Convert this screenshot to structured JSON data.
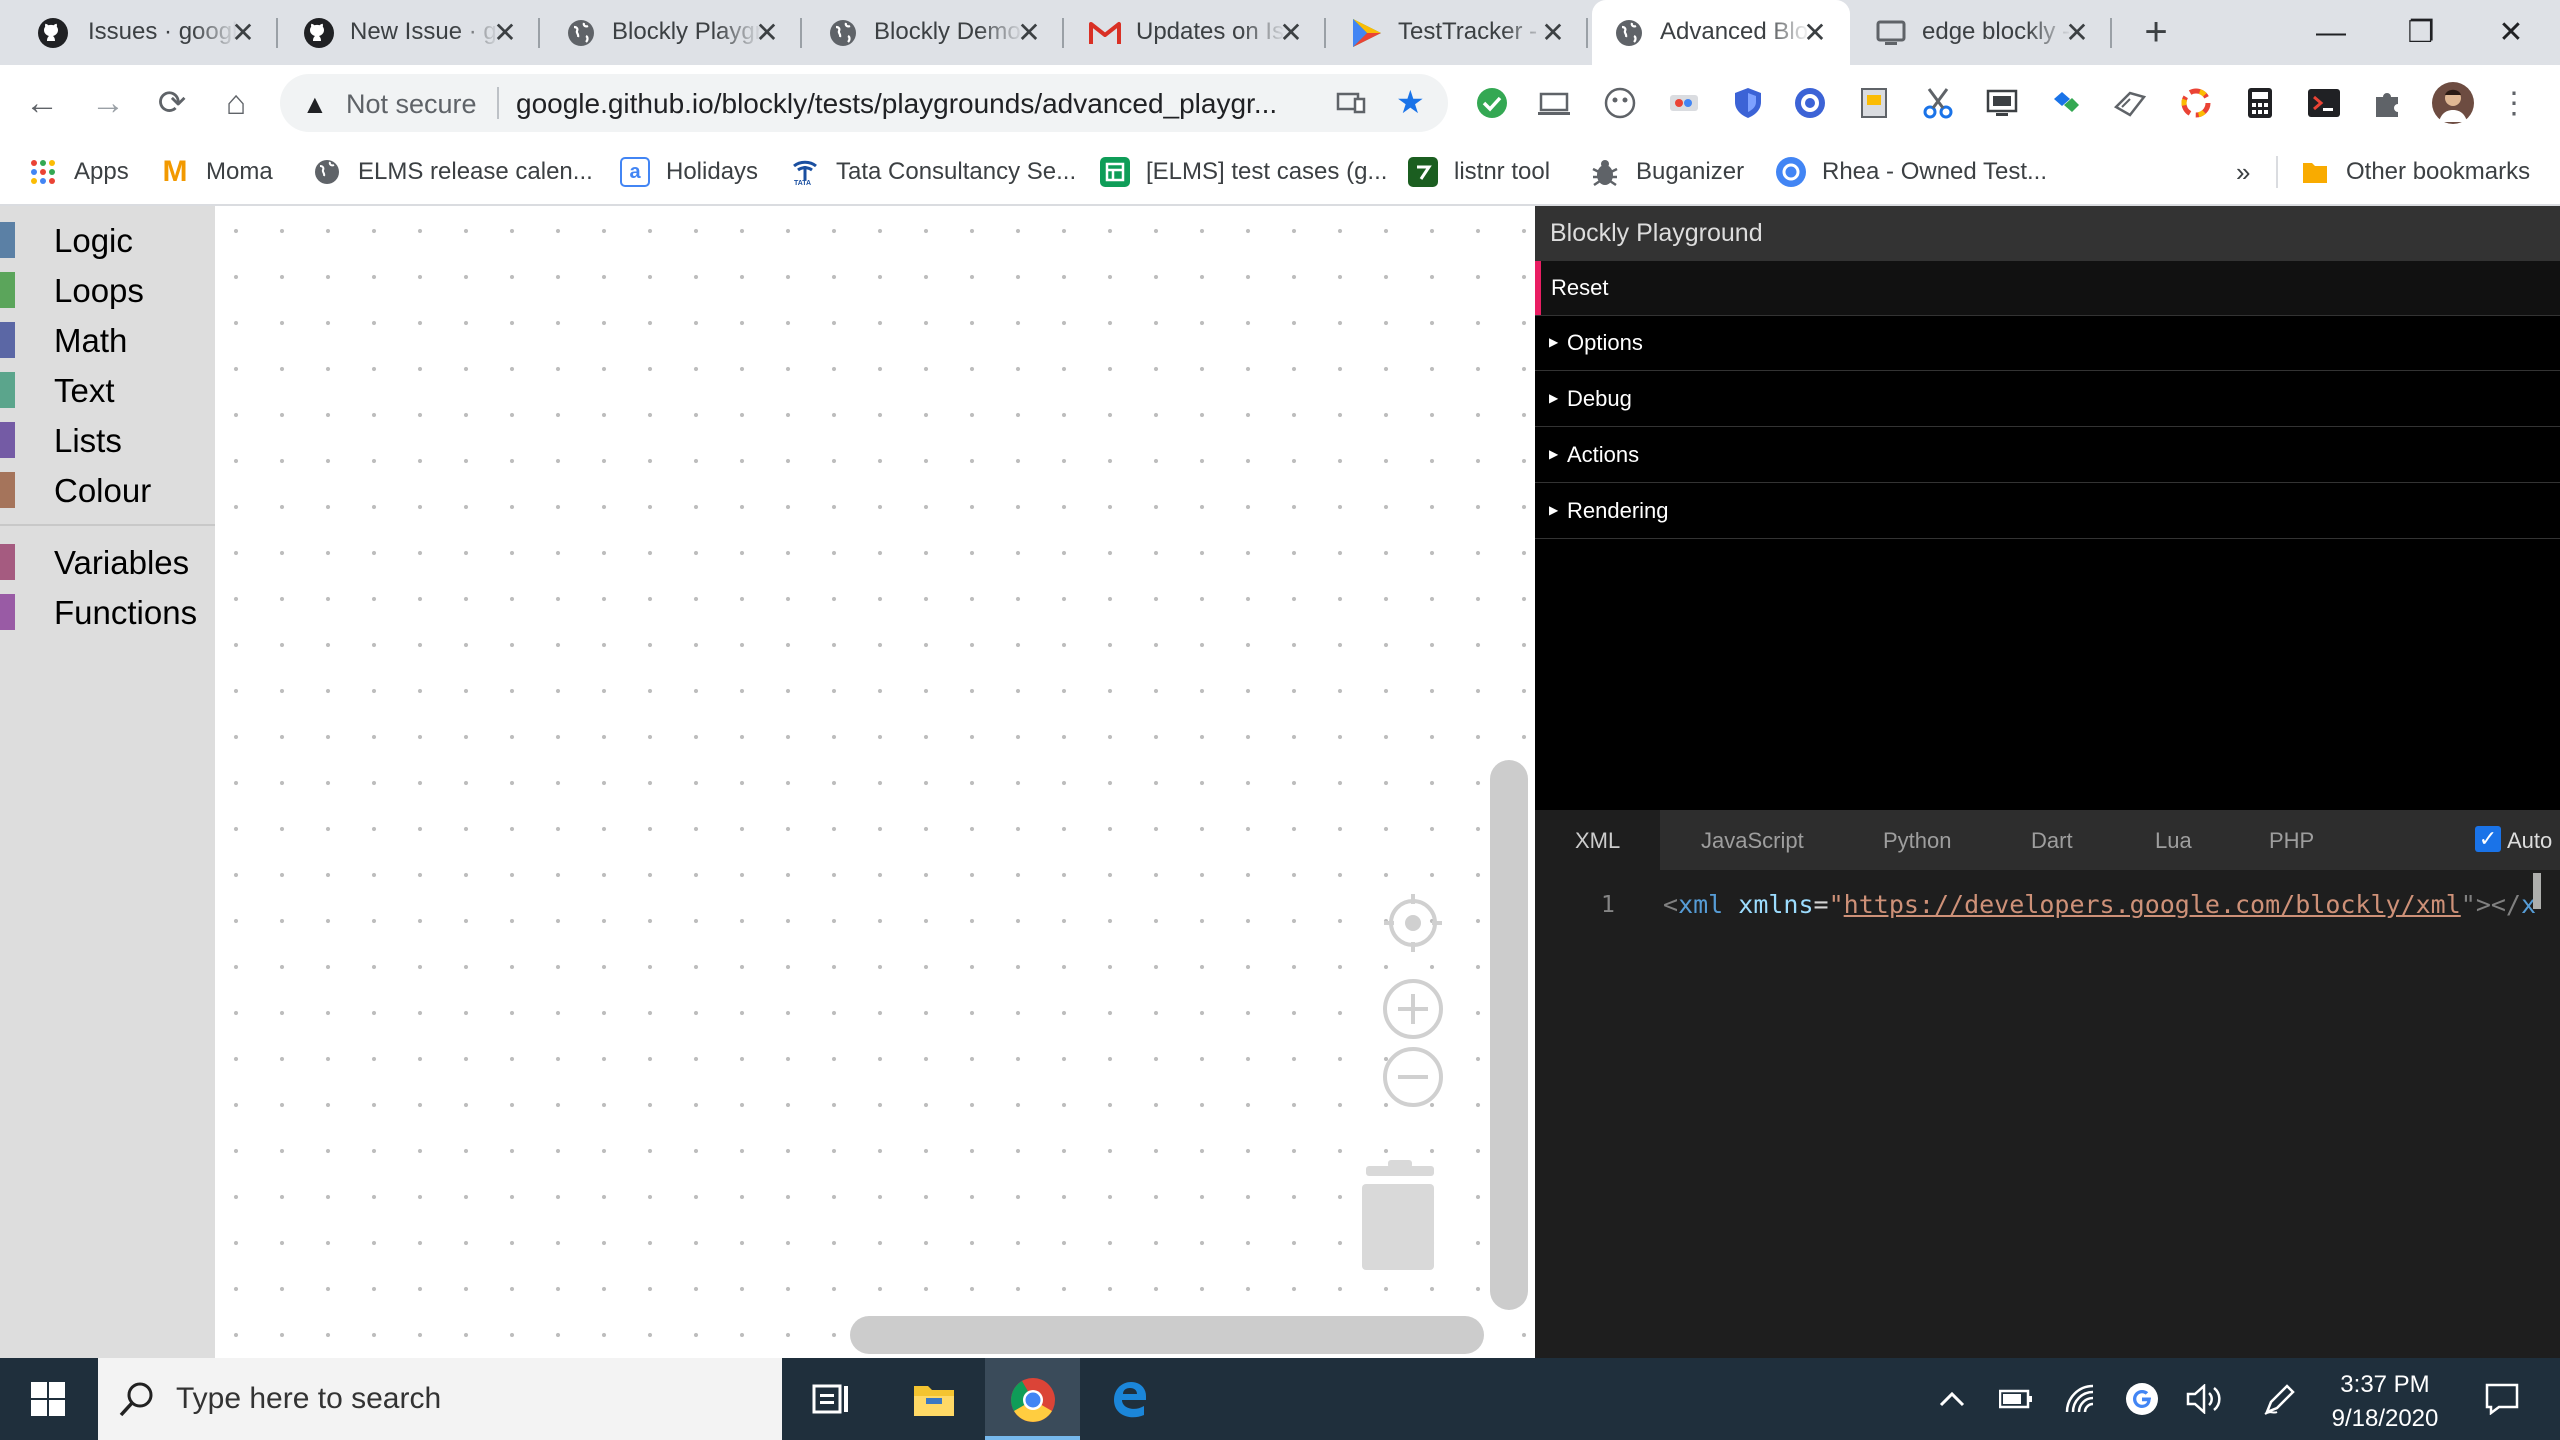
{
  "browser": {
    "tabs": [
      {
        "title": "Issues · google/blockly",
        "icon": "github-icon"
      },
      {
        "title": "New Issue · google/blockly",
        "icon": "github-icon"
      },
      {
        "title": "Blockly Playground",
        "icon": "globe-icon"
      },
      {
        "title": "Blockly Demo",
        "icon": "globe-icon"
      },
      {
        "title": "Updates on Issue",
        "icon": "gmail-icon"
      },
      {
        "title": "TestTracker - Home",
        "icon": "testtracker-icon"
      },
      {
        "title": "Advanced Blockly Playground",
        "icon": "globe-icon",
        "active": true
      },
      {
        "title": "edge blockly - Google Search",
        "icon": "monitor-icon"
      }
    ],
    "new_tab": "+",
    "window_controls": {
      "minimize": "—",
      "restore": "❐",
      "close": "✕"
    },
    "toolbar": {
      "back": "←",
      "forward": "→",
      "reload": "⟳",
      "home": "⌂",
      "security_icon": "▲",
      "security_text": "Not secure",
      "url": "google.github.io/blockly/tests/playgrounds/advanced_playgr...",
      "star_icon": "★"
    },
    "bookmarks": [
      {
        "label": "Apps",
        "icon": "apps-grid-icon"
      },
      {
        "label": "Moma",
        "icon": "moma-icon"
      },
      {
        "label": "ELMS release calen...",
        "icon": "globe-icon"
      },
      {
        "label": "Holidays",
        "icon": "holidays-icon"
      },
      {
        "label": "Tata Consultancy Se...",
        "icon": "tata-icon"
      },
      {
        "label": "[ELMS] test cases (g...",
        "icon": "sheets-icon"
      },
      {
        "label": "listnr tool",
        "icon": "listnr-icon"
      },
      {
        "label": "Buganizer",
        "icon": "bug-icon"
      },
      {
        "label": "Rhea - Owned Test...",
        "icon": "rhea-icon"
      }
    ],
    "bookmarks_overflow": "»",
    "other_bookmarks": "Other bookmarks"
  },
  "blockly": {
    "toolbox": [
      {
        "label": "Logic",
        "color": "#5b80a5"
      },
      {
        "label": "Loops",
        "color": "#5ba55b"
      },
      {
        "label": "Math",
        "color": "#5b67a5"
      },
      {
        "label": "Text",
        "color": "#5ba58c"
      },
      {
        "label": "Lists",
        "color": "#745ba5"
      },
      {
        "label": "Colour",
        "color": "#a5745b"
      },
      {
        "label": "Variables",
        "color": "#a55b80"
      },
      {
        "label": "Functions",
        "color": "#995ba5"
      }
    ]
  },
  "playground": {
    "title": "Blockly Playground",
    "reset": "Reset",
    "sections": [
      "Options",
      "Debug",
      "Actions",
      "Rendering"
    ],
    "code_tabs": [
      "XML",
      "JavaScript",
      "Python",
      "Dart",
      "Lua",
      "PHP"
    ],
    "auto_label": "Auto",
    "auto_checked": true,
    "line_number": "1",
    "code": {
      "open": "<",
      "tag": "xml",
      "attr": "xmlns",
      "eq": "=",
      "quote": "\"",
      "url": "https://developers.google.com/blockly/xml",
      "close": "\"></",
      "tail": "x"
    }
  },
  "taskbar": {
    "search_placeholder": "Type here to search",
    "time": "3:37 PM",
    "date": "9/18/2020"
  }
}
